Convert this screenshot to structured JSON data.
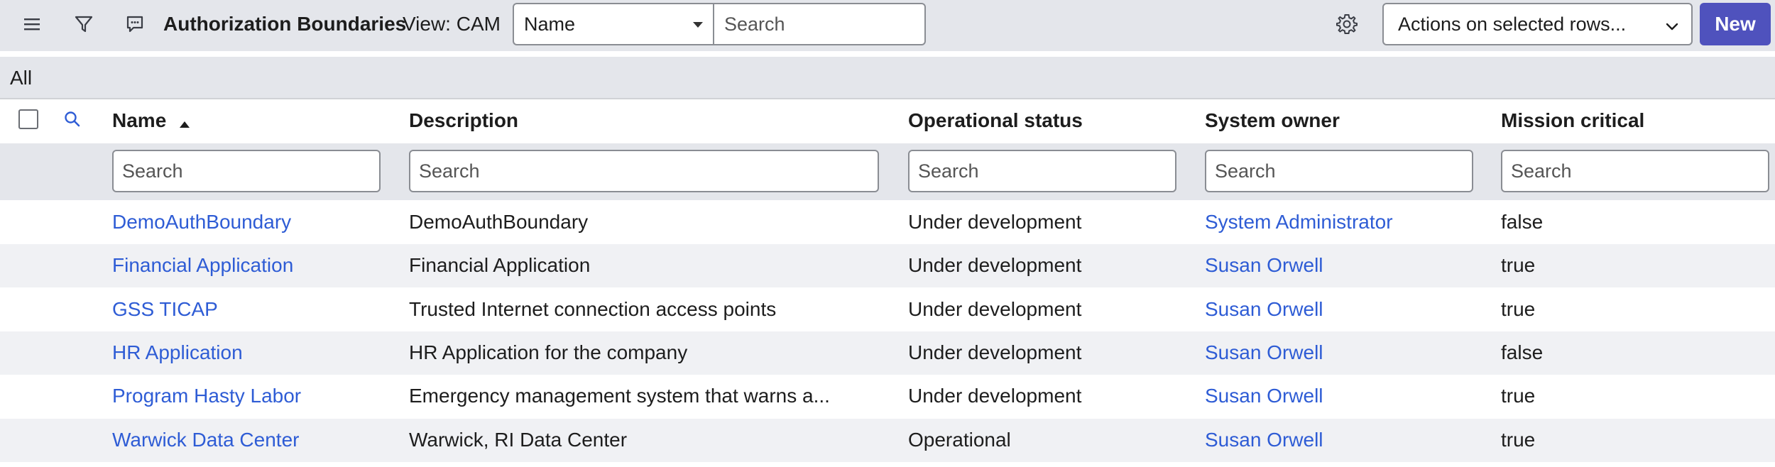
{
  "toolbar": {
    "title": "Authorization Boundaries",
    "view_label": "View: CAM",
    "field_select_value": "Name",
    "search_placeholder": "Search",
    "actions_label": "Actions on selected rows...",
    "new_label": "New"
  },
  "breadcrumb": "All",
  "columns": {
    "name": "Name",
    "description": "Description",
    "operational_status": "Operational status",
    "system_owner": "System owner",
    "mission_critical": "Mission critical"
  },
  "filter_placeholder": "Search",
  "rows": [
    {
      "name": "DemoAuthBoundary",
      "description": "DemoAuthBoundary",
      "status": "Under development",
      "owner": "System Administrator",
      "mission": "false"
    },
    {
      "name": "Financial Application",
      "description": "Financial Application",
      "status": "Under development",
      "owner": "Susan Orwell",
      "mission": "true"
    },
    {
      "name": "GSS TICAP",
      "description": "Trusted Internet connection access points",
      "status": "Under development",
      "owner": "Susan Orwell",
      "mission": "true"
    },
    {
      "name": "HR Application",
      "description": "HR Application for the company",
      "status": "Under development",
      "owner": "Susan Orwell",
      "mission": "false"
    },
    {
      "name": "Program Hasty Labor",
      "description": "Emergency management system that warns a...",
      "status": "Under development",
      "owner": "Susan Orwell",
      "mission": "true"
    },
    {
      "name": "Warwick Data Center",
      "description": "Warwick, RI Data Center",
      "status": "Operational",
      "owner": "Susan Orwell",
      "mission": "true"
    }
  ],
  "colors": {
    "accent": "#4f52bd",
    "link": "#2e5cd5",
    "toolbar_bg": "#e4e6eb",
    "row_alt": "#f0f1f4"
  },
  "icons": [
    "menu-icon",
    "filter-icon",
    "comment-icon",
    "gear-icon",
    "chevron-down-icon",
    "search-icon",
    "sort-asc-icon"
  ]
}
